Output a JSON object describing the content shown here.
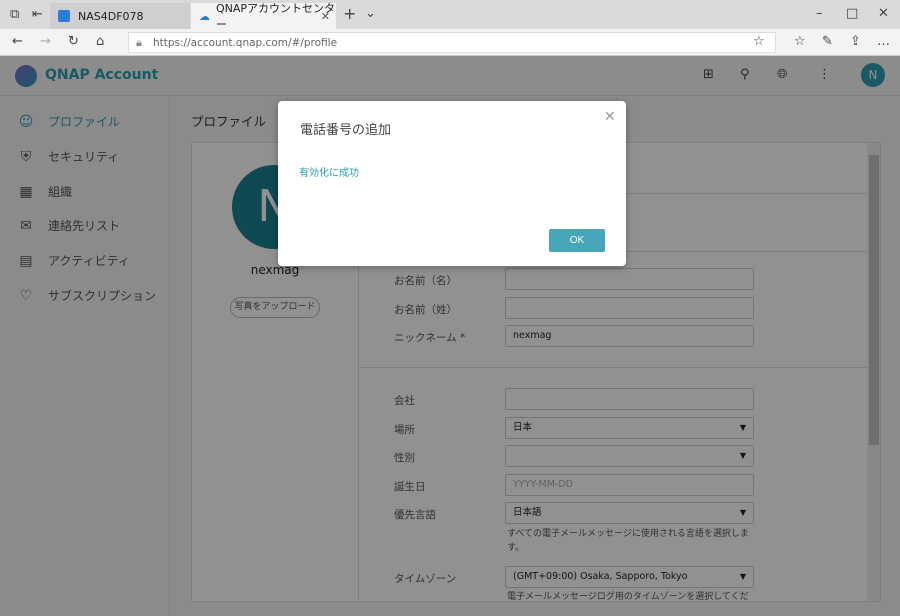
{
  "browser": {
    "tabs": [
      {
        "label": "NAS4DF078"
      },
      {
        "label": "QNAPアカウントセンター"
      }
    ],
    "url": "https://account.qnap.com/#/profile"
  },
  "app": {
    "brand": "QNAP Account",
    "avatar_letter": "N"
  },
  "sidebar": {
    "items": [
      {
        "label": "プロファイル"
      },
      {
        "label": "セキュリティ"
      },
      {
        "label": "組織"
      },
      {
        "label": "連絡先リスト"
      },
      {
        "label": "アクティビティ"
      },
      {
        "label": "サブスクリプション"
      }
    ]
  },
  "profile": {
    "title": "プロファイル",
    "avatar_letter": "N",
    "username": "nexmag",
    "upload_label": "写真をアップロード",
    "fields": {
      "first_name": {
        "label": "お名前（名）",
        "value": ""
      },
      "last_name": {
        "label": "お名前（姓）",
        "value": ""
      },
      "nickname": {
        "label": "ニックネーム *",
        "value": "nexmag"
      },
      "company": {
        "label": "会社",
        "value": ""
      },
      "location": {
        "label": "場所",
        "value": "日本"
      },
      "gender": {
        "label": "性別",
        "value": ""
      },
      "birthday": {
        "label": "誕生日",
        "placeholder": "YYYY-MM-DD"
      },
      "language": {
        "label": "優先言語",
        "value": "日本語",
        "help": "すべての電子メールメッセージに使用される言語を選択します。"
      },
      "timezone": {
        "label": "タイムゾーン",
        "value": "(GMT+09:00) Osaka, Sapporo, Tokyo",
        "help": "電子メールメッセージログ用のタイムゾーンを選択してくださ"
      }
    }
  },
  "modal": {
    "title": "電話番号の追加",
    "message": "有効化に成功",
    "ok_label": "OK"
  }
}
